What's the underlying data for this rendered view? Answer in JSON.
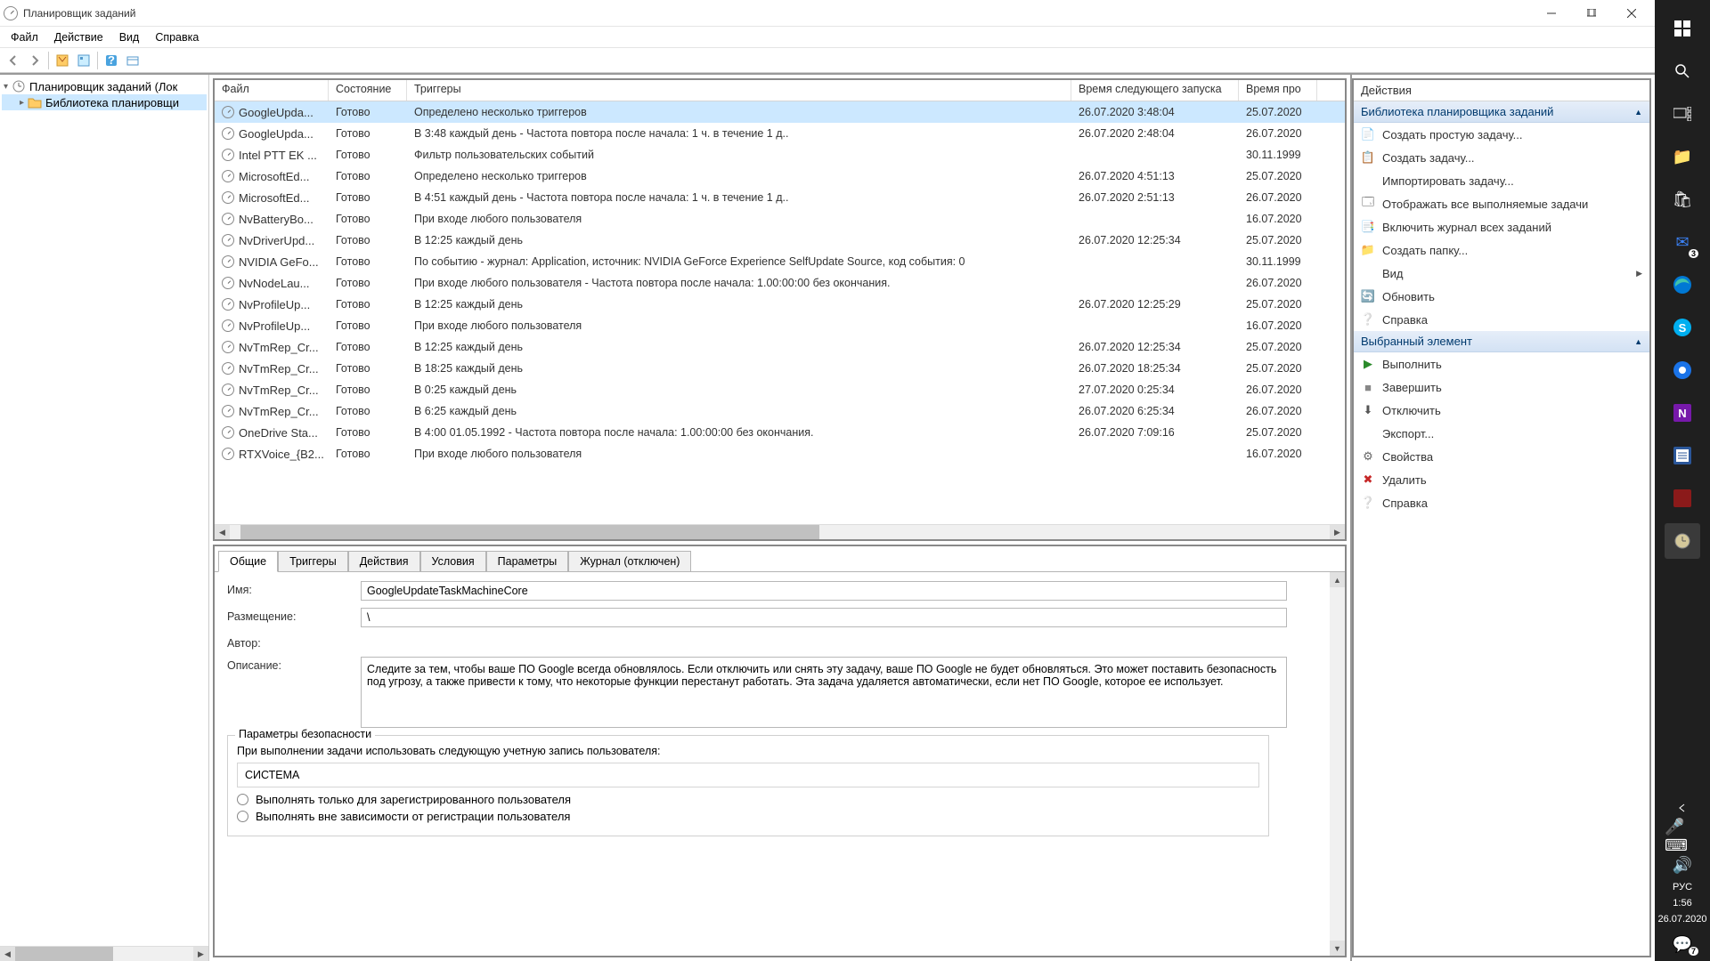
{
  "window": {
    "title": "Планировщик заданий"
  },
  "menu": [
    "Файл",
    "Действие",
    "Вид",
    "Справка"
  ],
  "tree": {
    "root": "Планировщик заданий (Лок",
    "lib": "Библиотека планировщи"
  },
  "columns": [
    "Файл",
    "Состояние",
    "Триггеры",
    "Время следующего запуска",
    "Время про"
  ],
  "tasks": [
    {
      "name": "GoogleUpda...",
      "state": "Готово",
      "trigger": "Определено несколько триггеров",
      "next": "26.07.2020 3:48:04",
      "last": "25.07.2020",
      "sel": true
    },
    {
      "name": "GoogleUpda...",
      "state": "Готово",
      "trigger": "В 3:48 каждый день - Частота повтора после начала: 1 ч. в течение 1 д..",
      "next": "26.07.2020 2:48:04",
      "last": "26.07.2020"
    },
    {
      "name": "Intel PTT EK ...",
      "state": "Готово",
      "trigger": "Фильтр пользовательских событий",
      "next": "",
      "last": "30.11.1999"
    },
    {
      "name": "MicrosoftEd...",
      "state": "Готово",
      "trigger": "Определено несколько триггеров",
      "next": "26.07.2020 4:51:13",
      "last": "25.07.2020"
    },
    {
      "name": "MicrosoftEd...",
      "state": "Готово",
      "trigger": "В 4:51 каждый день - Частота повтора после начала: 1 ч. в течение 1 д..",
      "next": "26.07.2020 2:51:13",
      "last": "26.07.2020"
    },
    {
      "name": "NvBatteryBo...",
      "state": "Готово",
      "trigger": "При входе любого пользователя",
      "next": "",
      "last": "16.07.2020"
    },
    {
      "name": "NvDriverUpd...",
      "state": "Готово",
      "trigger": "В 12:25 каждый день",
      "next": "26.07.2020 12:25:34",
      "last": "25.07.2020"
    },
    {
      "name": "NVIDIA GeFo...",
      "state": "Готово",
      "trigger": "По событию - журнал: Application, источник: NVIDIA GeForce Experience SelfUpdate Source, код события: 0",
      "next": "",
      "last": "30.11.1999"
    },
    {
      "name": "NvNodeLau...",
      "state": "Готово",
      "trigger": "При входе любого пользователя - Частота повтора после начала: 1.00:00:00 без окончания.",
      "next": "",
      "last": "26.07.2020"
    },
    {
      "name": "NvProfileUp...",
      "state": "Готово",
      "trigger": "В 12:25 каждый день",
      "next": "26.07.2020 12:25:29",
      "last": "25.07.2020"
    },
    {
      "name": "NvProfileUp...",
      "state": "Готово",
      "trigger": "При входе любого пользователя",
      "next": "",
      "last": "16.07.2020"
    },
    {
      "name": "NvTmRep_Cr...",
      "state": "Готово",
      "trigger": "В 12:25 каждый день",
      "next": "26.07.2020 12:25:34",
      "last": "25.07.2020"
    },
    {
      "name": "NvTmRep_Cr...",
      "state": "Готово",
      "trigger": "В 18:25 каждый день",
      "next": "26.07.2020 18:25:34",
      "last": "25.07.2020"
    },
    {
      "name": "NvTmRep_Cr...",
      "state": "Готово",
      "trigger": "В 0:25 каждый день",
      "next": "27.07.2020 0:25:34",
      "last": "26.07.2020"
    },
    {
      "name": "NvTmRep_Cr...",
      "state": "Готово",
      "trigger": "В 6:25 каждый день",
      "next": "26.07.2020 6:25:34",
      "last": "26.07.2020"
    },
    {
      "name": "OneDrive Sta...",
      "state": "Готово",
      "trigger": "В 4:00 01.05.1992 - Частота повтора после начала: 1.00:00:00 без окончания.",
      "next": "26.07.2020 7:09:16",
      "last": "25.07.2020"
    },
    {
      "name": "RTXVoice_{B2...",
      "state": "Готово",
      "trigger": "При входе любого пользователя",
      "next": "",
      "last": "16.07.2020"
    }
  ],
  "tabs": [
    "Общие",
    "Триггеры",
    "Действия",
    "Условия",
    "Параметры",
    "Журнал (отключен)"
  ],
  "form": {
    "name_lbl": "Имя:",
    "name_val": "GoogleUpdateTaskMachineCore",
    "loc_lbl": "Размещение:",
    "loc_val": "\\",
    "author_lbl": "Автор:",
    "author_val": "",
    "desc_lbl": "Описание:",
    "desc_val": "Следите за тем, чтобы ваше ПО Google всегда обновлялось. Если отключить или снять эту задачу, ваше ПО Google не будет обновляться. Это может поставить безопасность под угрозу, а также привести к тому, что некоторые функции перестанут работать. Эта задача удаляется автоматически, если нет ПО Google, которое ее использует.",
    "sec_title": "Параметры безопасности",
    "sec_account_lbl": "При выполнении задачи использовать следующую учетную запись пользователя:",
    "sec_account": "СИСТЕМА",
    "radio1": "Выполнять только для зарегистрированного пользователя",
    "radio2": "Выполнять вне зависимости от регистрации пользователя"
  },
  "actions": {
    "title": "Действия",
    "lib_section": "Библиотека планировщика заданий",
    "lib_items": [
      {
        "ico": "📄",
        "label": "Создать простую задачу..."
      },
      {
        "ico": "📋",
        "label": "Создать задачу..."
      },
      {
        "ico": "",
        "label": "Импортировать задачу..."
      },
      {
        "ico": "🗔",
        "label": "Отображать все выполняемые задачи"
      },
      {
        "ico": "📑",
        "label": "Включить журнал всех заданий"
      },
      {
        "ico": "📁",
        "label": "Создать папку..."
      },
      {
        "ico": "",
        "label": "Вид",
        "sub": true
      },
      {
        "ico": "🔄",
        "label": "Обновить"
      },
      {
        "ico": "❔",
        "label": "Справка"
      }
    ],
    "sel_section": "Выбранный элемент",
    "sel_items": [
      {
        "ico": "▶",
        "label": "Выполнить",
        "color": "#2a8a2a"
      },
      {
        "ico": "■",
        "label": "Завершить",
        "color": "#888"
      },
      {
        "ico": "⬇",
        "label": "Отключить",
        "color": "#555"
      },
      {
        "ico": "",
        "label": "Экспорт..."
      },
      {
        "ico": "⚙",
        "label": "Свойства",
        "color": "#666"
      },
      {
        "ico": "✖",
        "label": "Удалить",
        "color": "#c62828"
      },
      {
        "ico": "❔",
        "label": "Справка"
      }
    ]
  },
  "tray": {
    "lang": "РУС",
    "time": "1:56",
    "date": "26.07.2020",
    "mail_badge": "3",
    "list_badge": "7"
  }
}
